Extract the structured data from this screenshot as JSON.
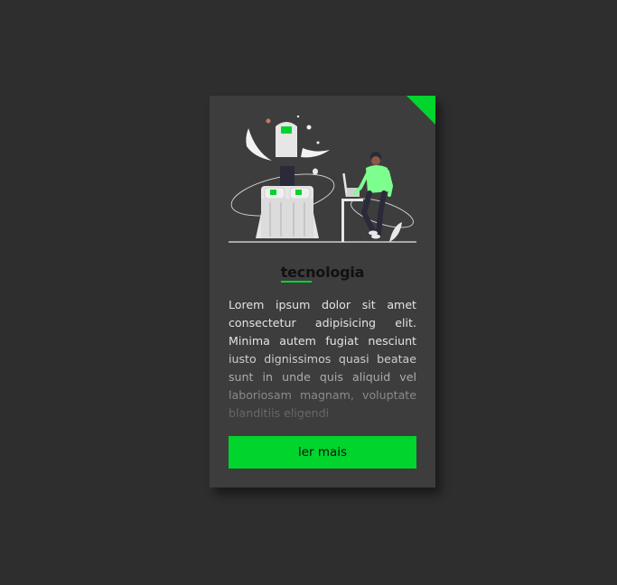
{
  "card": {
    "title": "tecnologia",
    "text": "Lorem ipsum dolor sit amet consectetur adipisicing elit. Minima autem fugiat nesciunt iusto dignissimos quasi beatae sunt in unde quis aliquid vel laboriosam magnam, voluptate blanditiis eligendi",
    "button_label": "ler mais",
    "illustration": "rocket-and-person-at-computer-illustration"
  },
  "colors": {
    "background": "#2e2e2e",
    "card": "#3d3d3d",
    "accent": "#00d42d"
  }
}
